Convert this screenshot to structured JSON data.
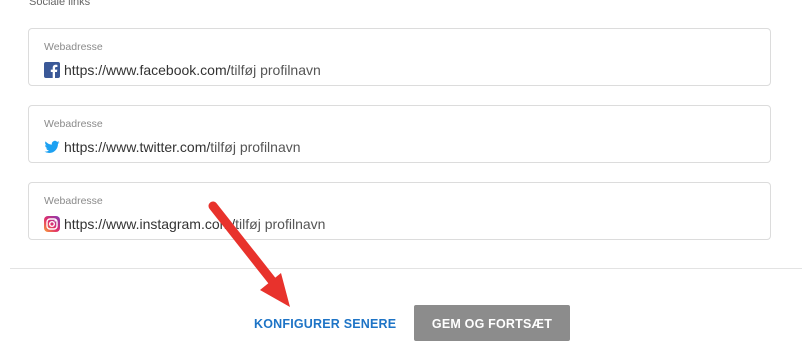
{
  "social_links": {
    "section_label": "Sociale links",
    "fields": [
      {
        "label": "Webadresse",
        "url": "https://www.facebook.com/",
        "suffix": "tilføj profilnavn",
        "icon": "facebook-icon"
      },
      {
        "label": "Webadresse",
        "url": "https://www.twitter.com/",
        "suffix": "tilføj profilnavn",
        "icon": "twitter-icon"
      },
      {
        "label": "Webadresse",
        "url": "https://www.instagram.com/",
        "suffix": "tilføj profilnavn",
        "icon": "instagram-icon"
      }
    ]
  },
  "actions": {
    "configure_later_label": "KONFIGURER SENERE",
    "save_continue_label": "GEM OG FORTSÆT"
  },
  "colors": {
    "link_blue": "#1e74c6",
    "button_gray": "#8c8c8c",
    "annotation_arrow": "#e8322c",
    "facebook": "#3b5998",
    "twitter": "#1da1f2"
  }
}
